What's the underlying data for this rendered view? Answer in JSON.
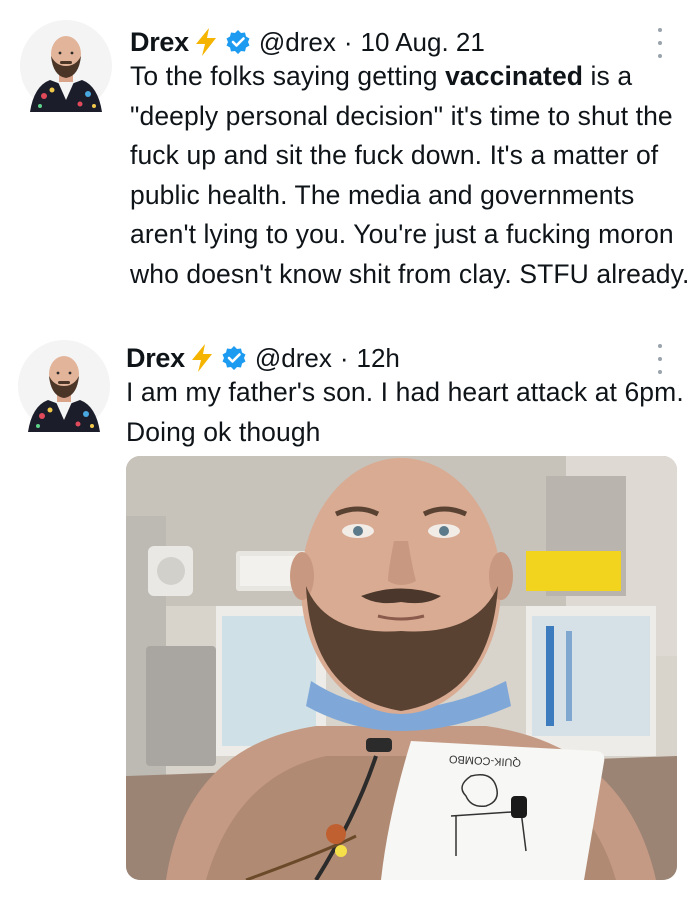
{
  "tweets": [
    {
      "display_name": "Drex",
      "handle": "@drex",
      "separator": "·",
      "timestamp": "10 Aug. 21",
      "text_lines": [
        "To the folks saying getting ",
        "vaccinated",
        " is a \"deeply personal decision\" it's time to shut the fuck up and sit the fuck down. It's a matter of public health. The media and governments aren't lying to you. You're just a fucking moron who doesn't know shit from clay. STFU already."
      ]
    },
    {
      "display_name": "Drex",
      "handle": "@drex",
      "separator": "·",
      "timestamp": "12h",
      "text": "I am my father's son. I had heart attack at 6pm. Doing ok though",
      "media": {
        "description_icon": "photo-icon",
        "pad_label": "QUIK-COMBO"
      }
    }
  ],
  "icons": {
    "bolt": "lightning-bolt-emoji",
    "verified": "verified-badge-icon",
    "more": "more-options-icon"
  },
  "colors": {
    "verified_blue": "#1d9bf0",
    "bolt_yellow": "#f5b400",
    "text": "#0f1419",
    "secondary": "#9aa4ad"
  }
}
